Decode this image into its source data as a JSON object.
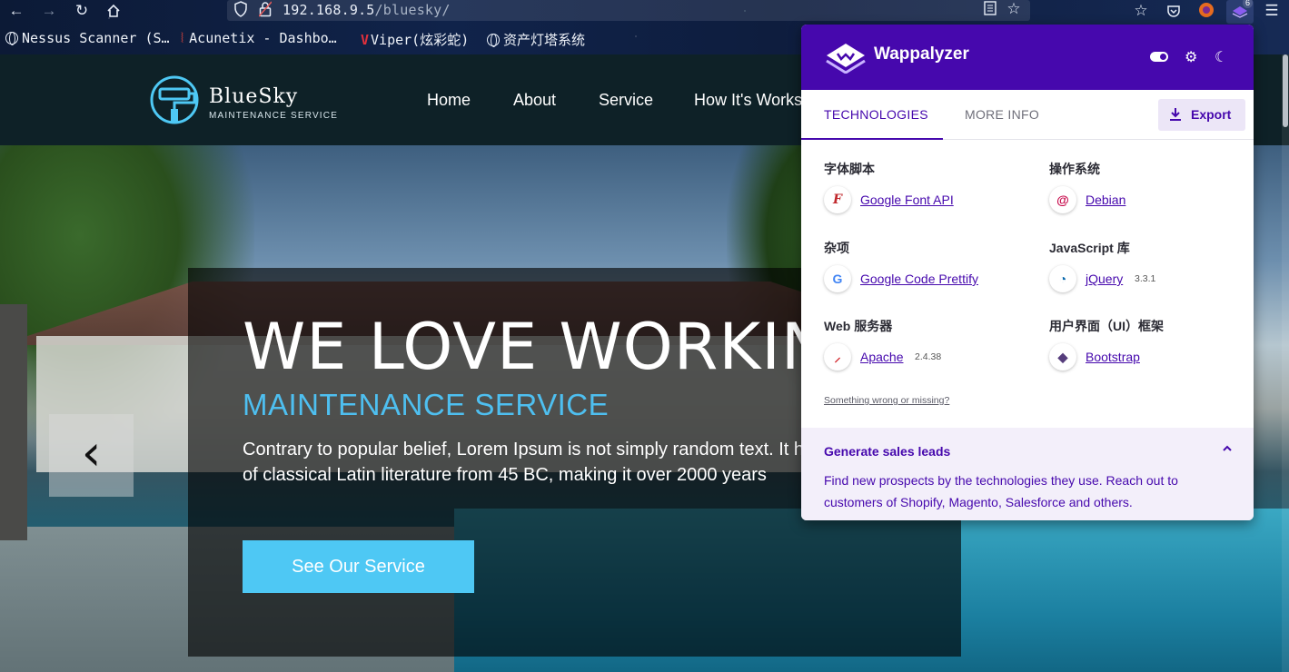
{
  "browser": {
    "url_host": "192.168.9.5",
    "url_path": "/bluesky/",
    "extension_badge": "6",
    "bookmarks": [
      {
        "label": "Nessus Scanner (S…"
      },
      {
        "label": "Acunetix - Dashbo…"
      },
      {
        "label": "Viper(炫彩蛇)"
      },
      {
        "label": "资产灯塔系统"
      }
    ]
  },
  "site": {
    "logo_title": "BlueSky",
    "logo_subtitle": "MAINTENANCE SERVICE",
    "nav": [
      "Home",
      "About",
      "Service",
      "How It's Works"
    ],
    "hero": {
      "title": "WE LOVE WORKING",
      "subtitle": "MAINTENANCE SERVICE",
      "body": "Contrary to popular belief, Lorem Ipsum is not simply random text. It has roots in a piece of classical Latin literature from 45 BC, making it over 2000 years",
      "button": "See Our Service",
      "prev_glyph": "‹"
    }
  },
  "wappalyzer": {
    "brand": "Wappalyzer",
    "tabs": {
      "technologies": "TECHNOLOGIES",
      "more_info": "MORE INFO"
    },
    "export_label": "Export",
    "categories": [
      {
        "name": "字体脚本",
        "tech": "Google Font API",
        "version": "",
        "icon": "google-font-api-icon"
      },
      {
        "name": "操作系统",
        "tech": "Debian",
        "version": "",
        "icon": "debian-icon"
      },
      {
        "name": "杂项",
        "tech": "Google Code Prettify",
        "version": "",
        "icon": "google-icon"
      },
      {
        "name": "JavaScript 库",
        "tech": "jQuery",
        "version": "3.3.1",
        "icon": "jquery-icon"
      },
      {
        "name": "Web 服务器",
        "tech": "Apache",
        "version": "2.4.38",
        "icon": "apache-icon"
      },
      {
        "name": "用户界面（UI）框架",
        "tech": "Bootstrap",
        "version": "",
        "icon": "bootstrap-icon"
      }
    ],
    "wrong_link": "Something wrong or missing?",
    "leads": {
      "title": "Generate sales leads",
      "body": "Find new prospects by the technologies they use. Reach out to customers of Shopify, Magento, Salesforce and others."
    },
    "colors": {
      "brand": "#4608ad",
      "accent_soft": "#f3effa"
    }
  }
}
